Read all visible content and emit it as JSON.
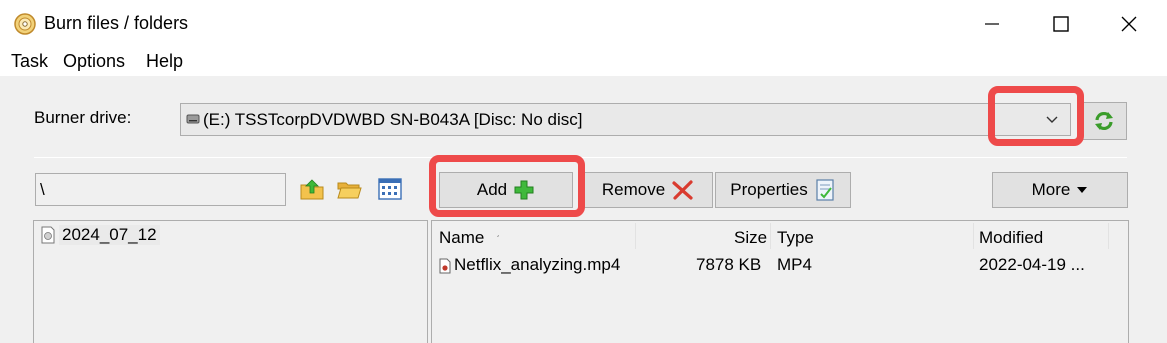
{
  "window": {
    "title": "Burn files / folders",
    "icon": "disc-icon"
  },
  "menu": {
    "items": [
      "Task",
      "Options",
      "Help"
    ]
  },
  "burner": {
    "label": "Burner drive:",
    "drive_value": "(E:) TSSTcorpDVDWBD SN-B043A [Disc: No disc]"
  },
  "toolbar": {
    "path_value": "\\",
    "add_label": "Add",
    "remove_label": "Remove",
    "properties_label": "Properties",
    "more_label": "More"
  },
  "tree": {
    "items": [
      {
        "label": "2024_07_12"
      }
    ]
  },
  "file_list": {
    "columns": [
      "Name",
      "Size",
      "Type",
      "Modified"
    ],
    "rows": [
      {
        "name": "Netflix_analyzing.mp4",
        "size": "7878 KB",
        "type": "MP4",
        "modified": "2022-04-19 ..."
      }
    ]
  },
  "colors": {
    "highlight": "#ee4a4a",
    "add_icon": "#3fb93b",
    "remove_icon": "#d93b2f"
  }
}
